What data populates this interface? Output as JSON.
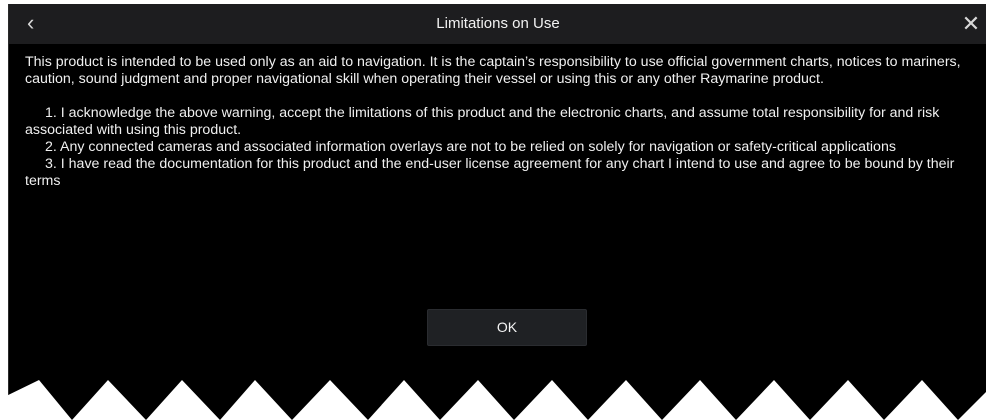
{
  "dialog": {
    "title": "Limitations on Use",
    "back_icon": "chevron-left-icon",
    "close_icon": "close-icon",
    "intro": "This product is intended to be used only as an aid to navigation. It is the captain’s responsibility to use official government charts, notices to mariners, caution, sound judgment and proper navigational skill when operating their vessel or using this or any other Raymarine product.",
    "items": [
      "1.  I acknowledge the above warning, accept the limitations of this product and the electronic charts, and assume total responsibility for and risk associated with using this product.",
      "2.  Any connected cameras and associated information overlays are not to be relied on solely for navigation or safety-critical applications",
      "3.  I have read the documentation for this product and the end-user license agreement for any chart I intend to use and agree to be bound by their terms"
    ],
    "ok_label": "OK"
  },
  "colors": {
    "background": "#000000",
    "titlebar": "#1d1d1f",
    "text": "#f0f0f0",
    "button": "#1f2124"
  }
}
